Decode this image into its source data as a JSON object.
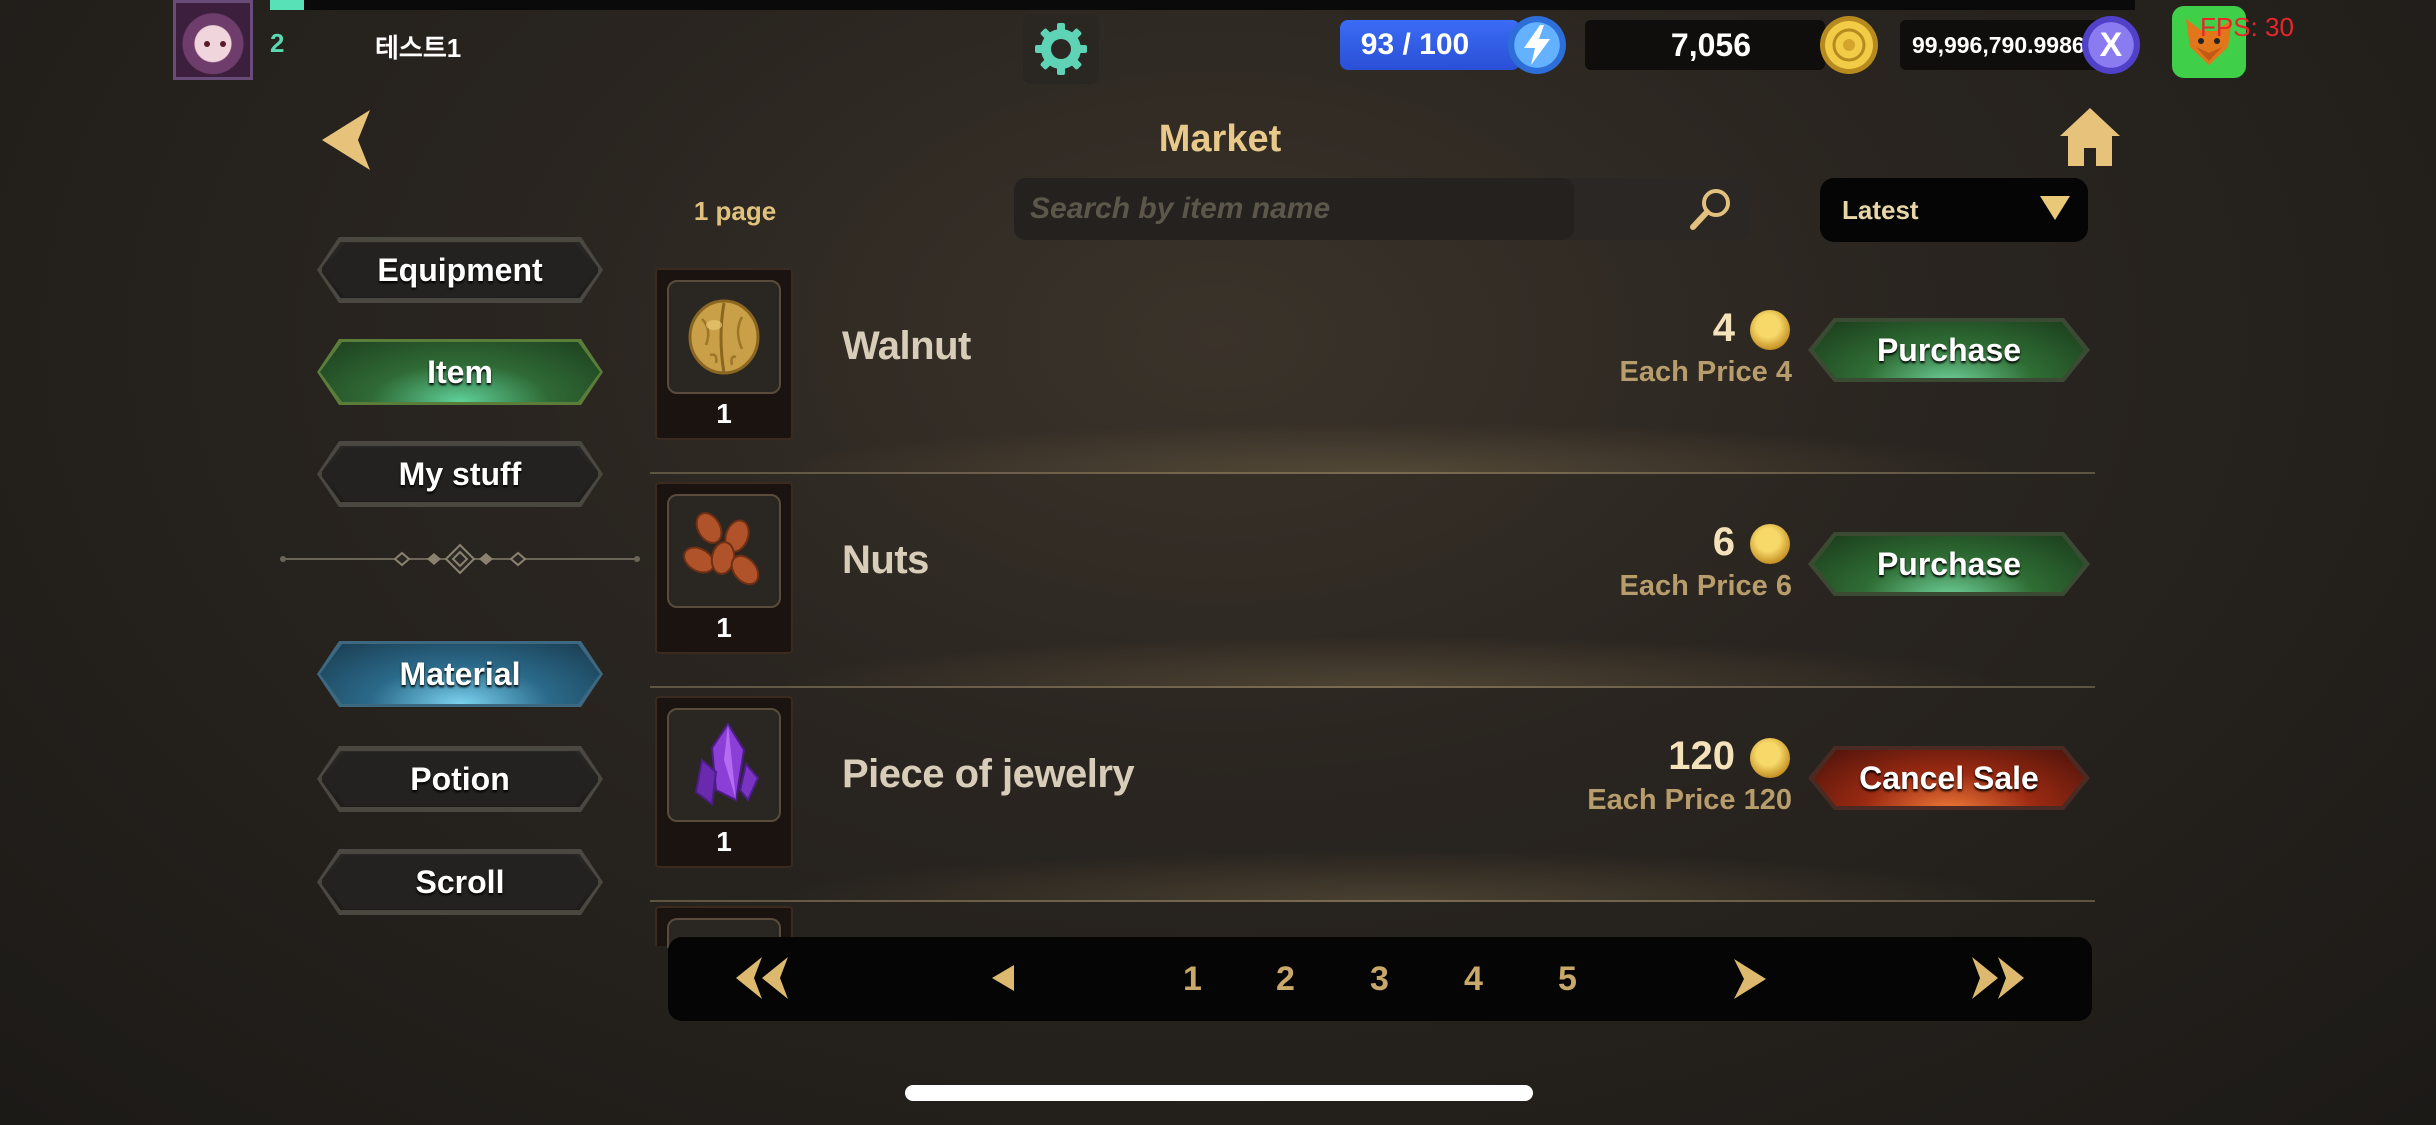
{
  "player": {
    "level": "2",
    "name": "테스트1"
  },
  "resources": {
    "energy": "93 / 100",
    "gold": "7,056",
    "token": "99,996,790.9986"
  },
  "debug": {
    "fps": "FPS: 30"
  },
  "header": {
    "title": "Market",
    "page_label": "1 page"
  },
  "search": {
    "placeholder": "Search by item name",
    "value": ""
  },
  "sort": {
    "selected": "Latest"
  },
  "sidebar": {
    "tabs": [
      {
        "label": "Equipment",
        "state": "normal"
      },
      {
        "label": "Item",
        "state": "active"
      },
      {
        "label": "My stuff",
        "state": "normal"
      },
      {
        "label": "Material",
        "state": "selected"
      },
      {
        "label": "Potion",
        "state": "normal"
      },
      {
        "label": "Scroll",
        "state": "normal"
      }
    ]
  },
  "listings": [
    {
      "name": "Walnut",
      "qty": "1",
      "price": "4",
      "each": "Each Price 4",
      "action": "Purchase",
      "icon": "walnut-icon"
    },
    {
      "name": "Nuts",
      "qty": "1",
      "price": "6",
      "each": "Each Price 6",
      "action": "Purchase",
      "icon": "nuts-icon"
    },
    {
      "name": "Piece of jewelry",
      "qty": "1",
      "price": "120",
      "each": "Each Price 120",
      "action": "Cancel Sale",
      "icon": "purple-crystal-icon"
    }
  ],
  "pagination": {
    "pages": [
      "1",
      "2",
      "3",
      "4",
      "5"
    ],
    "current": "1"
  },
  "colors": {
    "accent_gold": "#e8c98a",
    "energy_blue": "#3b6cf5",
    "purchase_green": "#2f6d34",
    "cancel_red": "#9b2a12",
    "fps_red": "#e8262a"
  }
}
